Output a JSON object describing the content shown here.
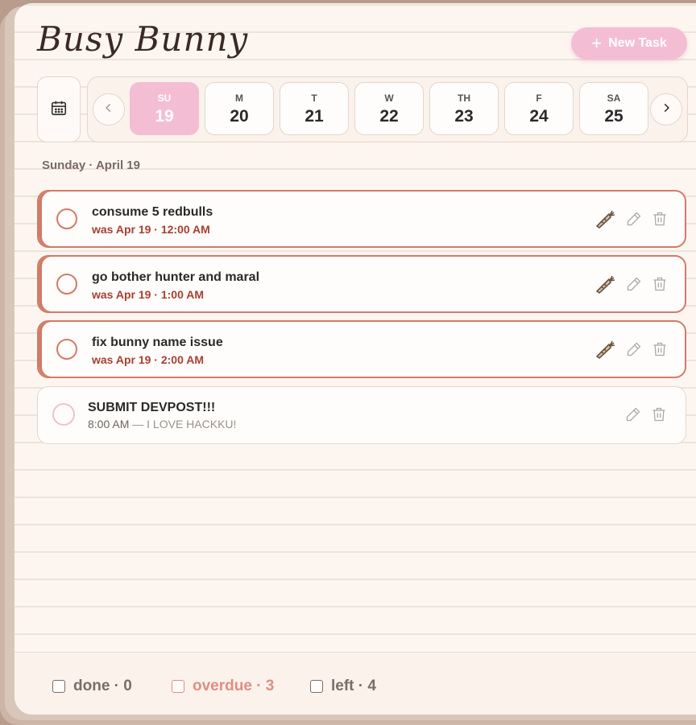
{
  "app": {
    "title": "Busy Bunny",
    "new_task_label": "New Task"
  },
  "week": {
    "days": [
      {
        "dow": "SU",
        "num": "19",
        "active": true
      },
      {
        "dow": "M",
        "num": "20"
      },
      {
        "dow": "T",
        "num": "21"
      },
      {
        "dow": "W",
        "num": "22"
      },
      {
        "dow": "TH",
        "num": "23"
      },
      {
        "dow": "F",
        "num": "24"
      },
      {
        "dow": "SA",
        "num": "25"
      }
    ]
  },
  "date_label": "Sunday · April 19",
  "tasks": [
    {
      "title": "consume 5 redbulls",
      "subtitle": "was Apr 19 · 12:00 AM",
      "overdue": true
    },
    {
      "title": "go bother hunter and maral",
      "subtitle": "was Apr 19 · 1:00 AM",
      "overdue": true
    },
    {
      "title": "fix bunny name issue",
      "subtitle": "was Apr 19 · 2:00 AM",
      "overdue": true
    },
    {
      "title": "SUBMIT DEVPOST!!!",
      "time": "8:00 AM",
      "note": "— I LOVE HACKKU!",
      "overdue": false
    }
  ],
  "stats": {
    "done": "done · 0",
    "overdue": "overdue · 3",
    "left": "left · 4"
  },
  "colors": {
    "accent": "#f3bed3",
    "overdue": "#d27b68",
    "overdue_text": "#a83f33"
  },
  "icons": {
    "calendar": "calendar-icon",
    "carrot": "carrot-icon",
    "edit": "pencil-icon",
    "delete": "trash-icon"
  }
}
